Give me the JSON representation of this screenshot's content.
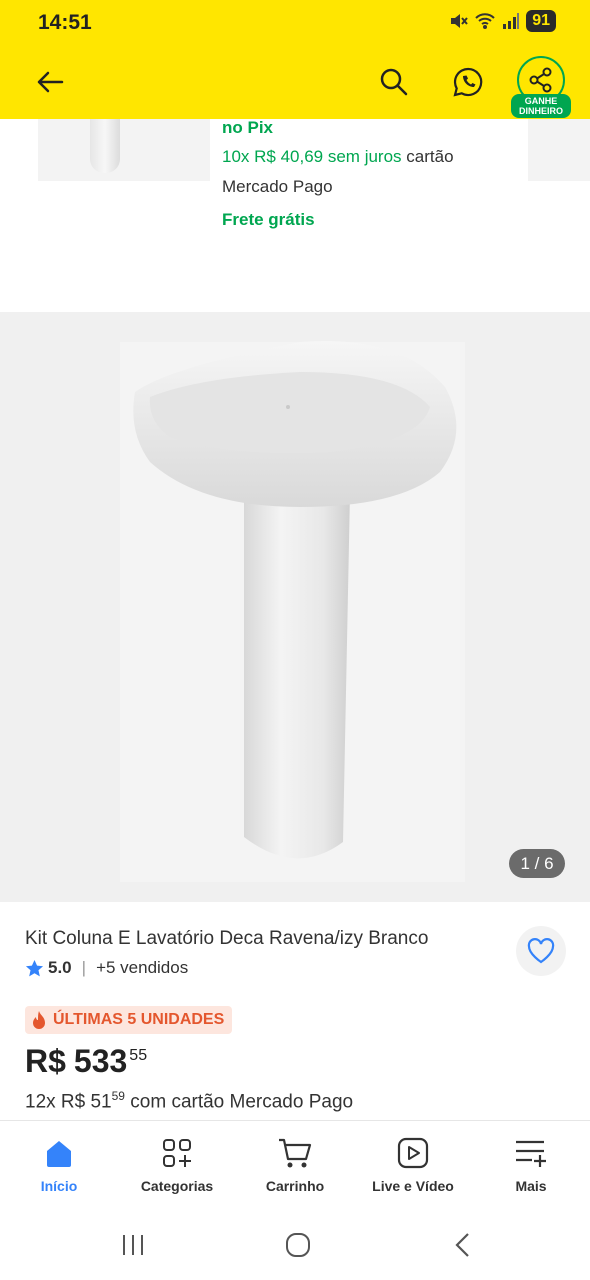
{
  "status_bar": {
    "time": "14:51",
    "battery": "91"
  },
  "header": {
    "ganhe_line1": "GANHE",
    "ganhe_line2": "DINHEIRO"
  },
  "previous_card": {
    "pix_text": "no Pix",
    "installments_green": "10x R$ 40,69 sem juros",
    "installments_rest": "cartão",
    "installments_line2": "Mercado Pago",
    "shipping": "Frete grátis"
  },
  "gallery": {
    "pager": "1 / 6"
  },
  "product": {
    "title": "Kit Coluna E Lavatório Deca Ravena/izy Branco",
    "rating": "5.0",
    "sold": "+5 vendidos",
    "stock_badge": "ÚLTIMAS 5 UNIDADES",
    "currency": "R$",
    "price_int": "533",
    "price_cents": "55",
    "inst_prefix": "12x R$ 51",
    "inst_cents": "59",
    "inst_suffix": "com cartão Mercado Pago"
  },
  "bottom_nav": {
    "items": [
      {
        "label": "Início",
        "icon": "home-icon"
      },
      {
        "label": "Categorias",
        "icon": "categories-icon"
      },
      {
        "label": "Carrinho",
        "icon": "cart-icon"
      },
      {
        "label": "Live e Vídeo",
        "icon": "video-icon"
      },
      {
        "label": "Mais",
        "icon": "more-icon"
      }
    ]
  },
  "colors": {
    "header_yellow": "#ffe600",
    "green": "#00a650",
    "blue": "#3483fa",
    "badge_orange": "#e4572e"
  }
}
